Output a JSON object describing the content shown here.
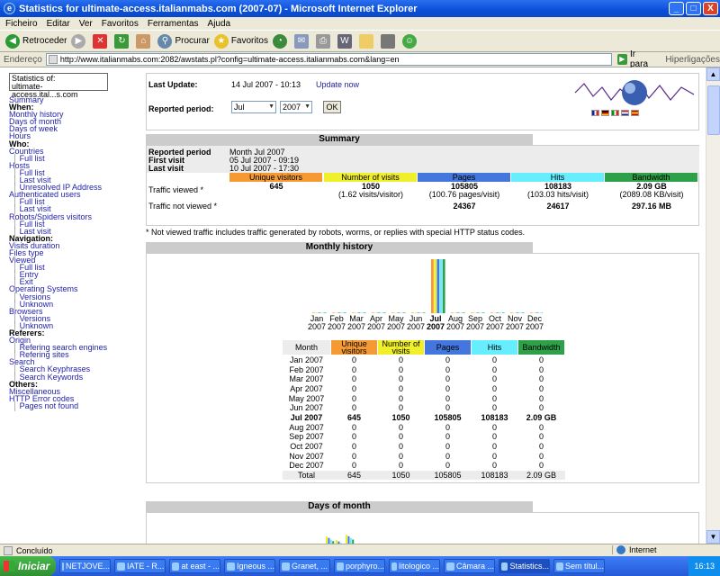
{
  "window": {
    "title": "Statistics for ultimate-access.italianmabs.com (2007-07) - Microsoft Internet Explorer",
    "min": "_",
    "max": "□",
    "close": "X"
  },
  "menu": [
    "Ficheiro",
    "Editar",
    "Ver",
    "Favoritos",
    "Ferramentas",
    "Ajuda"
  ],
  "toolbar": {
    "back": "Retroceder",
    "search": "Procurar",
    "favorites": "Favoritos"
  },
  "address": {
    "label": "Endereço",
    "url": "http://www.italianmabs.com:2082/awstats.pl?config=ultimate-access.italianmabs.com&lang=en",
    "go": "Ir para",
    "links": "Hiperligações"
  },
  "sidebar": {
    "site": [
      "Statistics of:",
      "ultimate-access.ital...s.com"
    ],
    "nav": [
      {
        "t": "Summary",
        "k": "link"
      },
      {
        "t": "When:",
        "k": "sec"
      },
      {
        "t": "Monthly history",
        "k": "link"
      },
      {
        "t": "Days of month",
        "k": "link"
      },
      {
        "t": "Days of week",
        "k": "link"
      },
      {
        "t": "Hours",
        "k": "link"
      },
      {
        "t": "Who:",
        "k": "sec"
      },
      {
        "t": "Countries",
        "k": "link"
      },
      {
        "t": "Full list",
        "k": "sub"
      },
      {
        "t": "Hosts",
        "k": "link"
      },
      {
        "t": "Full list",
        "k": "sub"
      },
      {
        "t": "Last visit",
        "k": "sub"
      },
      {
        "t": "Unresolved IP Address",
        "k": "sub"
      },
      {
        "t": "Authenticated users",
        "k": "link"
      },
      {
        "t": "Full list",
        "k": "sub"
      },
      {
        "t": "Last visit",
        "k": "sub"
      },
      {
        "t": "Robots/Spiders visitors",
        "k": "link"
      },
      {
        "t": "Full list",
        "k": "sub"
      },
      {
        "t": "Last visit",
        "k": "sub"
      },
      {
        "t": "Navigation:",
        "k": "sec"
      },
      {
        "t": "Visits duration",
        "k": "link"
      },
      {
        "t": "Files type",
        "k": "link"
      },
      {
        "t": "Viewed",
        "k": "link"
      },
      {
        "t": "Full list",
        "k": "sub"
      },
      {
        "t": "Entry",
        "k": "sub"
      },
      {
        "t": "Exit",
        "k": "sub"
      },
      {
        "t": "Operating Systems",
        "k": "link"
      },
      {
        "t": "Versions",
        "k": "sub"
      },
      {
        "t": "Unknown",
        "k": "sub"
      },
      {
        "t": "Browsers",
        "k": "link"
      },
      {
        "t": "Versions",
        "k": "sub"
      },
      {
        "t": "Unknown",
        "k": "sub"
      },
      {
        "t": "Referers:",
        "k": "sec"
      },
      {
        "t": "Origin",
        "k": "link"
      },
      {
        "t": "Refering search engines",
        "k": "sub"
      },
      {
        "t": "Refering sites",
        "k": "sub"
      },
      {
        "t": "Search",
        "k": "link"
      },
      {
        "t": "Search Keyphrases",
        "k": "sub"
      },
      {
        "t": "Search Keywords",
        "k": "sub"
      },
      {
        "t": "Others:",
        "k": "sec"
      },
      {
        "t": "Miscellaneous",
        "k": "link"
      },
      {
        "t": "HTTP Error codes",
        "k": "link"
      },
      {
        "t": "Pages not found",
        "k": "sub"
      }
    ]
  },
  "header": {
    "last_update_label": "Last Update:",
    "last_update": "14 Jul 2007 - 10:13",
    "update_now": "Update now",
    "period_label": "Reported period:",
    "month": "Jul",
    "year": "2007",
    "ok": "OK"
  },
  "summary": {
    "title": "Summary",
    "info": [
      {
        "l": "Reported period",
        "v": "Month Jul 2007"
      },
      {
        "l": "First visit",
        "v": "05 Jul 2007 - 09:19"
      },
      {
        "l": "Last visit",
        "v": "10 Jul 2007 - 17:30"
      }
    ],
    "headers": [
      "Unique visitors",
      "Number of visits",
      "Pages",
      "Hits",
      "Bandwidth"
    ],
    "viewed_label": "Traffic viewed *",
    "viewed": [
      "645",
      "1050",
      "105805",
      "108183",
      "2.09 GB"
    ],
    "viewed_sub": [
      "",
      "(1.62 visits/visitor)",
      "(100.76 pages/visit)",
      "(103.03 hits/visit)",
      "(2089.08 KB/visit)"
    ],
    "notviewed_label": "Traffic not viewed *",
    "notviewed": [
      "",
      "",
      "24367",
      "24617",
      "297.16 MB"
    ],
    "note": "* Not viewed traffic includes traffic generated by robots, worms, or replies with special HTTP status codes."
  },
  "monthly": {
    "title": "Monthly history",
    "year": "2007",
    "headers": [
      "Month",
      "Unique visitors",
      "Number of visits",
      "Pages",
      "Hits",
      "Bandwidth"
    ],
    "rows": [
      [
        "Jan 2007",
        "0",
        "0",
        "0",
        "0",
        "0"
      ],
      [
        "Feb 2007",
        "0",
        "0",
        "0",
        "0",
        "0"
      ],
      [
        "Mar 2007",
        "0",
        "0",
        "0",
        "0",
        "0"
      ],
      [
        "Apr 2007",
        "0",
        "0",
        "0",
        "0",
        "0"
      ],
      [
        "May 2007",
        "0",
        "0",
        "0",
        "0",
        "0"
      ],
      [
        "Jun 2007",
        "0",
        "0",
        "0",
        "0",
        "0"
      ],
      [
        "Jul 2007",
        "645",
        "1050",
        "105805",
        "108183",
        "2.09 GB"
      ],
      [
        "Aug 2007",
        "0",
        "0",
        "0",
        "0",
        "0"
      ],
      [
        "Sep 2007",
        "0",
        "0",
        "0",
        "0",
        "0"
      ],
      [
        "Oct 2007",
        "0",
        "0",
        "0",
        "0",
        "0"
      ],
      [
        "Nov 2007",
        "0",
        "0",
        "0",
        "0",
        "0"
      ],
      [
        "Dec 2007",
        "0",
        "0",
        "0",
        "0",
        "0"
      ]
    ],
    "total": [
      "Total",
      "645",
      "1050",
      "105805",
      "108183",
      "2.09 GB"
    ]
  },
  "days": {
    "title": "Days of month"
  },
  "colors": {
    "visitors": "#f59a33",
    "visits": "#f0f02a",
    "pages": "#4477dd",
    "hits": "#66eeff",
    "bandwidth": "#2ea04a"
  },
  "chart_data": {
    "type": "bar",
    "categories": [
      "Jan",
      "Feb",
      "Mar",
      "Apr",
      "May",
      "Jun",
      "Jul",
      "Aug",
      "Sep",
      "Oct",
      "Nov",
      "Dec"
    ],
    "series": [
      {
        "name": "Unique visitors",
        "values": [
          0,
          0,
          0,
          0,
          0,
          0,
          645,
          0,
          0,
          0,
          0,
          0
        ]
      },
      {
        "name": "Number of visits",
        "values": [
          0,
          0,
          0,
          0,
          0,
          0,
          1050,
          0,
          0,
          0,
          0,
          0
        ]
      },
      {
        "name": "Pages",
        "values": [
          0,
          0,
          0,
          0,
          0,
          0,
          105805,
          0,
          0,
          0,
          0,
          0
        ]
      },
      {
        "name": "Hits",
        "values": [
          0,
          0,
          0,
          0,
          0,
          0,
          108183,
          0,
          0,
          0,
          0,
          0
        ]
      },
      {
        "name": "Bandwidth",
        "values": [
          0,
          0,
          0,
          0,
          0,
          0,
          2.09,
          0,
          0,
          0,
          0,
          0
        ]
      }
    ]
  },
  "status": {
    "text": "Concluído",
    "zone": "Internet"
  },
  "taskbar": {
    "start": "Iniciar",
    "items": [
      "NETJOVE...",
      "IATE - R...",
      "at east - ...",
      "Igneous ...",
      "Granet, ...",
      "porphyro...",
      "litologico ...",
      "Câmara ...",
      "Statistics...",
      "Sem títul..."
    ],
    "time": "16:13"
  }
}
